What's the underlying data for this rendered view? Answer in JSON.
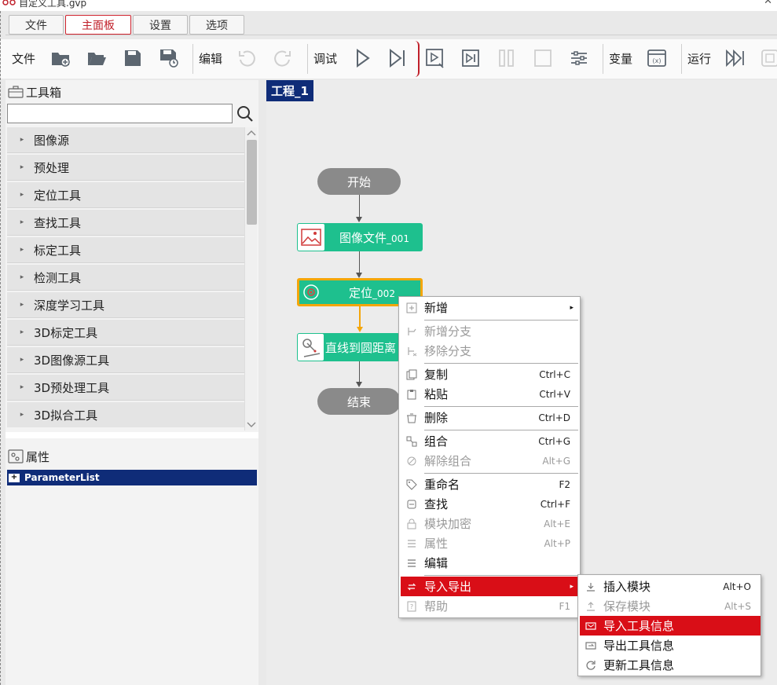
{
  "window": {
    "title": "自定义工具.gvp",
    "close": "✕"
  },
  "tabs": [
    "文件",
    "主面板",
    "设置",
    "选项"
  ],
  "toolbar": {
    "file_label": "文件",
    "edit_label": "编辑",
    "debug_label": "调试",
    "var_label": "变量",
    "run_label": "运行"
  },
  "toolbox": {
    "title": "工具箱",
    "search_placeholder": "",
    "items": [
      "图像源",
      "预处理",
      "定位工具",
      "查找工具",
      "标定工具",
      "检测工具",
      "深度学习工具",
      "3D标定工具",
      "3D图像源工具",
      "3D预处理工具",
      "3D拟合工具"
    ]
  },
  "properties": {
    "title": "属性",
    "root": "ParameterList",
    "expand_glyph": "+"
  },
  "canvas": {
    "project_tab": "工程_1",
    "start": "开始",
    "end": "结束",
    "node1": {
      "name": "图像文件",
      "suffix": "_001"
    },
    "node2": {
      "name": "定位",
      "suffix": "_002"
    },
    "node3": {
      "name": "直线到圆距离"
    }
  },
  "context_menu": [
    {
      "label": "新增",
      "shortcut": "",
      "disabled": false,
      "submenu": true
    },
    {
      "label": "新增分支",
      "shortcut": "",
      "disabled": true
    },
    {
      "label": "移除分支",
      "shortcut": "",
      "disabled": true
    },
    {
      "label": "复制",
      "shortcut": "Ctrl+C",
      "disabled": false
    },
    {
      "label": "粘贴",
      "shortcut": "Ctrl+V",
      "disabled": false
    },
    {
      "label": "删除",
      "shortcut": "Ctrl+D",
      "disabled": false
    },
    {
      "label": "组合",
      "shortcut": "Ctrl+G",
      "disabled": false
    },
    {
      "label": "解除组合",
      "shortcut": "Alt+G",
      "disabled": true
    },
    {
      "label": "重命名",
      "shortcut": "F2",
      "disabled": false
    },
    {
      "label": "查找",
      "shortcut": "Ctrl+F",
      "disabled": false
    },
    {
      "label": "模块加密",
      "shortcut": "Alt+E",
      "disabled": true
    },
    {
      "label": "属性",
      "shortcut": "Alt+P",
      "disabled": true
    },
    {
      "label": "编辑",
      "shortcut": "",
      "disabled": false
    },
    {
      "label": "导入导出",
      "shortcut": "",
      "disabled": false,
      "submenu": true,
      "highlighted": true
    },
    {
      "label": "帮助",
      "shortcut": "F1",
      "disabled": true
    }
  ],
  "submenu": [
    {
      "label": "插入模块",
      "shortcut": "Alt+O",
      "disabled": false
    },
    {
      "label": "保存模块",
      "shortcut": "Alt+S",
      "disabled": true
    },
    {
      "label": "导入工具信息",
      "shortcut": "",
      "disabled": false,
      "highlighted": true
    },
    {
      "label": "导出工具信息",
      "shortcut": "",
      "disabled": false
    },
    {
      "label": "更新工具信息",
      "shortcut": "",
      "disabled": false
    }
  ],
  "colors": {
    "accent_red": "#d90e17",
    "node_green": "#1ec08e",
    "selection_orange": "#f4a60a",
    "nav_blue": "#0f2c78"
  },
  "submenu_glyph": "▸",
  "tree_glyph": "▸"
}
